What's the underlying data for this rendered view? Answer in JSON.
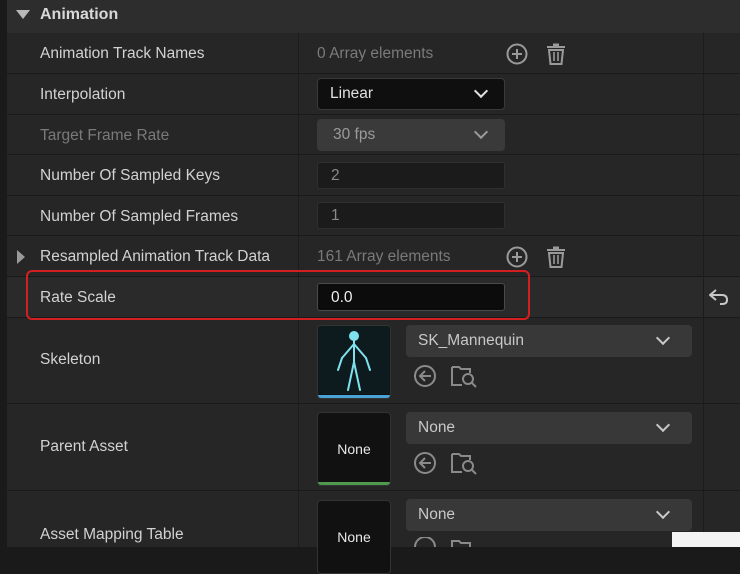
{
  "section": {
    "title": "Animation"
  },
  "rows": {
    "track_names": {
      "label": "Animation Track Names",
      "value": "0 Array elements"
    },
    "interpolation": {
      "label": "Interpolation",
      "value": "Linear"
    },
    "frame_rate": {
      "label": "Target Frame Rate",
      "value": "30 fps"
    },
    "sampled_keys": {
      "label": "Number Of Sampled Keys",
      "value": "2"
    },
    "sampled_frames": {
      "label": "Number Of Sampled Frames",
      "value": "1"
    },
    "resampled": {
      "label": "Resampled Animation Track Data",
      "value": "161 Array elements"
    },
    "rate_scale": {
      "label": "Rate Scale",
      "value": "0.0"
    },
    "skeleton": {
      "label": "Skeleton",
      "value": "SK_Mannequin"
    },
    "parent_asset": {
      "label": "Parent Asset",
      "value": "None",
      "thumb": "None"
    },
    "mapping_table": {
      "label": "Asset Mapping Table",
      "value": "None",
      "thumb": "None"
    }
  },
  "colors": {
    "highlight": "#d31f1f",
    "skeleton_bar": "#4aa3d8",
    "parent_bar": "#4f9a4f"
  },
  "icons": [
    "chevron-down-icon",
    "add-circle-icon",
    "trash-icon",
    "reset-arrow-icon",
    "browse-back-icon",
    "find-in-browser-icon",
    "expand-arrow-icon"
  ]
}
